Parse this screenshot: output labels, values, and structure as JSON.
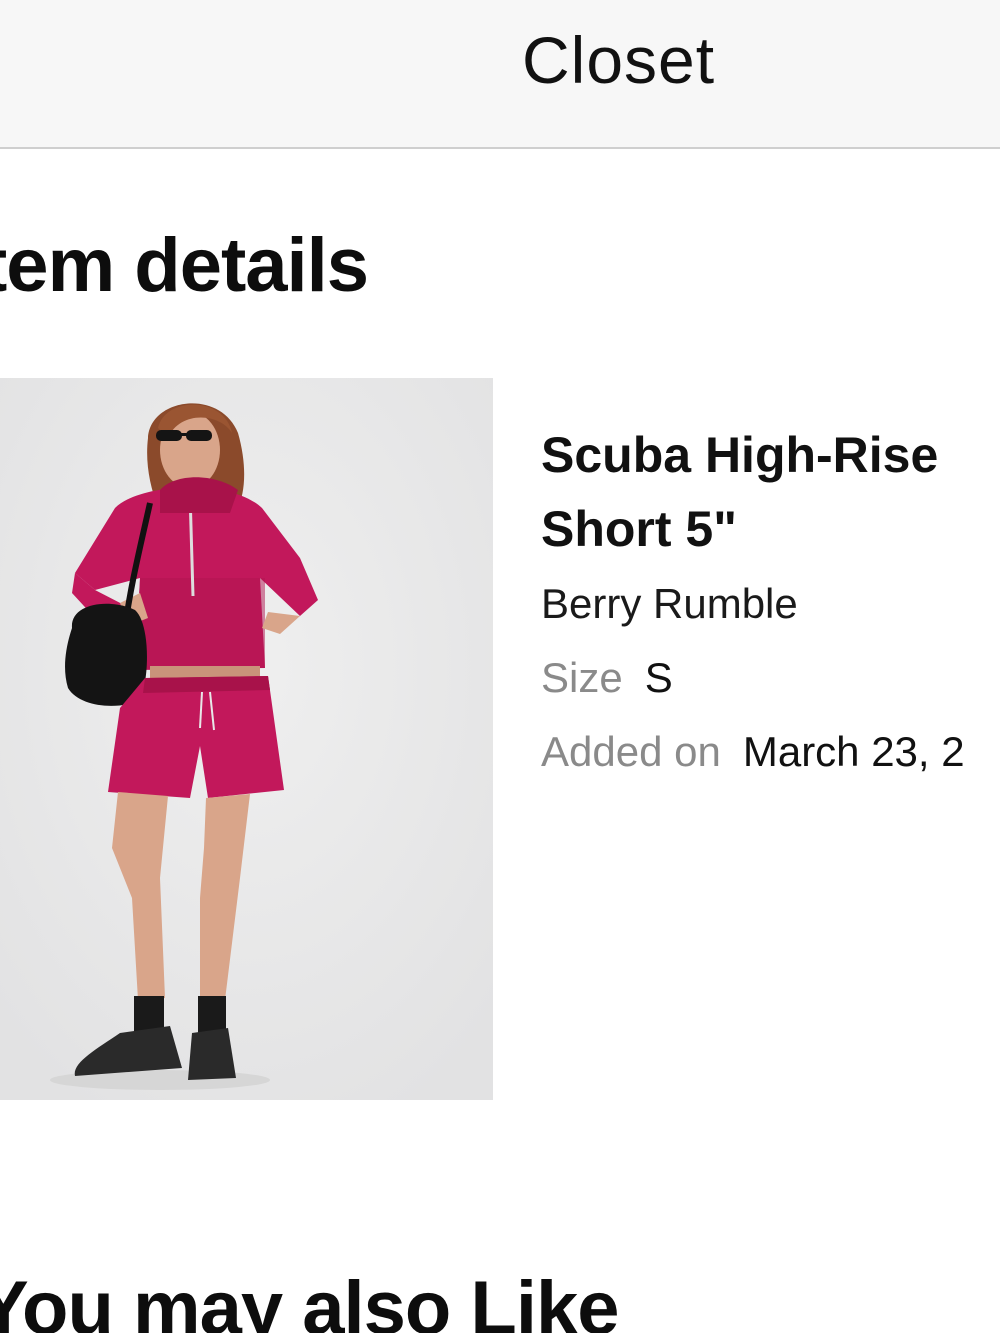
{
  "header": {
    "title": "Closet"
  },
  "main": {
    "section_title": "tem details",
    "product": {
      "image_alt": "Model wearing Scuba High-Rise Short 5\" in Berry Rumble",
      "name": "Scuba High-Rise Short 5\"",
      "color": "Berry Rumble",
      "size_label": "Size",
      "size_value": "S",
      "added_label": "Added on",
      "added_value": "March 23, 2"
    },
    "recommendations_title": "You may also Like"
  },
  "colors": {
    "accent_product": "#c2185b",
    "image_background": "#e9e9ea",
    "muted_text": "#8a8a8a"
  }
}
